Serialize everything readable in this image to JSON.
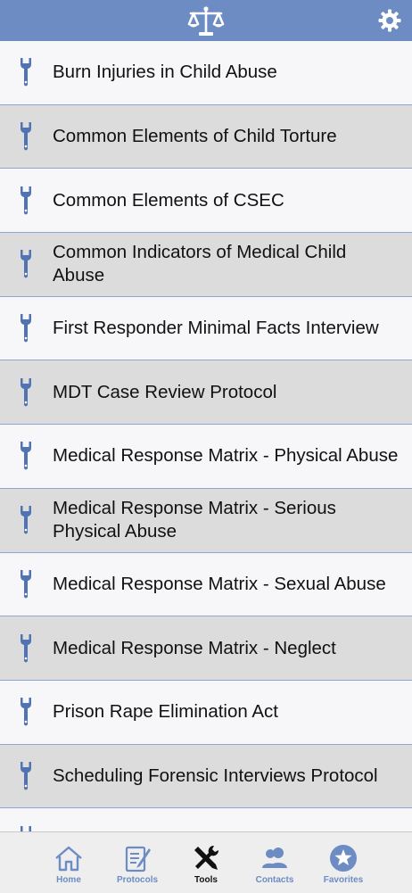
{
  "header": {
    "logo_icon": "scales-of-justice-icon",
    "settings_icon": "gear-icon"
  },
  "list": {
    "items": [
      {
        "label": "Burn Injuries in Child Abuse"
      },
      {
        "label": "Common Elements of Child Torture"
      },
      {
        "label": "Common Elements of CSEC"
      },
      {
        "label": "Common Indicators of Medical Child Abuse"
      },
      {
        "label": "First Responder Minimal Facts Interview"
      },
      {
        "label": "MDT Case Review Protocol"
      },
      {
        "label": "Medical Response Matrix - Physical Abuse"
      },
      {
        "label": "Medical Response Matrix - Serious Physical Abuse"
      },
      {
        "label": "Medical Response Matrix - Sexual Abuse"
      },
      {
        "label": "Medical Response Matrix - Neglect"
      },
      {
        "label": "Prison Rape Elimination Act"
      },
      {
        "label": "Scheduling Forensic Interviews Protocol"
      },
      {
        "label": ""
      }
    ]
  },
  "tabbar": {
    "tabs": [
      {
        "label": "Home",
        "icon": "home-icon"
      },
      {
        "label": "Protocols",
        "icon": "document-pen-icon"
      },
      {
        "label": "Tools",
        "icon": "tools-icon",
        "active": true
      },
      {
        "label": "Contacts",
        "icon": "contacts-icon"
      },
      {
        "label": "Favorites",
        "icon": "star-icon"
      }
    ]
  },
  "colors": {
    "header_bg": "#6d8cc4",
    "accent": "#6d8cc4",
    "wrench": "#4f73b3",
    "row_alt": "#dcdcdc",
    "row_plain": "#f7f7f9",
    "divider": "#8aa6d6"
  }
}
